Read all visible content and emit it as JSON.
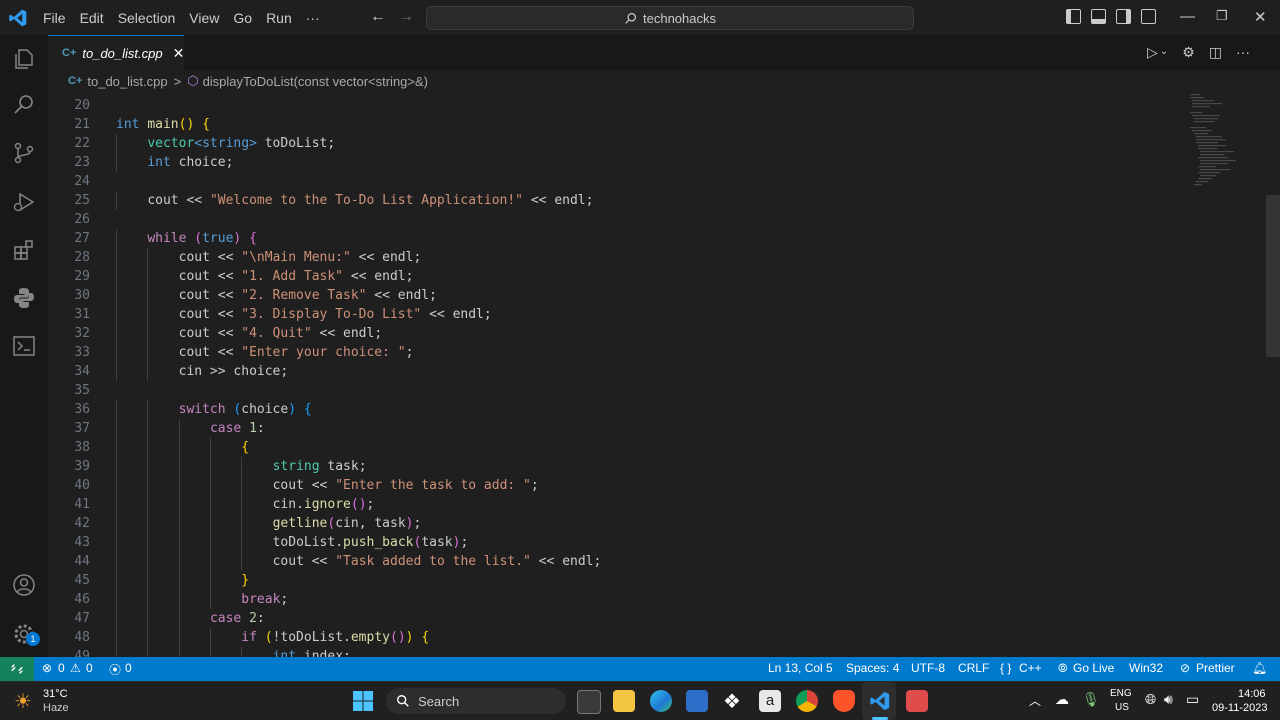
{
  "menu": [
    "File",
    "Edit",
    "Selection",
    "View",
    "Go",
    "Run",
    "···"
  ],
  "command_center": "technohacks",
  "tab": {
    "icon": "C+",
    "label": "to_do_list.cpp",
    "close": "✕"
  },
  "breadcrumb": {
    "file_icon": "C+",
    "file": "to_do_list.cpp",
    "separator": ">",
    "symbol_icon": "⬡",
    "symbol": "displayToDoList(const vector<string>&)"
  },
  "code_lines": [
    {
      "n": "20",
      "indent": 0,
      "tokens": []
    },
    {
      "n": "21",
      "indent": 0,
      "tokens": [
        [
          "kw",
          "int"
        ],
        [
          "p",
          " "
        ],
        [
          "fn",
          "main"
        ],
        [
          "br1",
          "()"
        ],
        [
          "p",
          " "
        ],
        [
          "br1",
          "{"
        ]
      ]
    },
    {
      "n": "22",
      "indent": 1,
      "tokens": [
        [
          "ty",
          "vector"
        ],
        [
          "kw",
          "<string>"
        ],
        [
          "p",
          " toDoList;"
        ]
      ]
    },
    {
      "n": "23",
      "indent": 1,
      "tokens": [
        [
          "kw",
          "int"
        ],
        [
          "p",
          " choice;"
        ]
      ]
    },
    {
      "n": "24",
      "indent": 0,
      "tokens": []
    },
    {
      "n": "25",
      "indent": 1,
      "tokens": [
        [
          "p",
          "cout << "
        ],
        [
          "str",
          "\"Welcome to the To-Do List Application!\""
        ],
        [
          "p",
          " << endl;"
        ]
      ]
    },
    {
      "n": "26",
      "indent": 0,
      "tokens": []
    },
    {
      "n": "27",
      "indent": 1,
      "tokens": [
        [
          "ctl",
          "while"
        ],
        [
          "p",
          " "
        ],
        [
          "br2",
          "("
        ],
        [
          "kw",
          "true"
        ],
        [
          "br2",
          ")"
        ],
        [
          "p",
          " "
        ],
        [
          "br2",
          "{"
        ]
      ]
    },
    {
      "n": "28",
      "indent": 2,
      "tokens": [
        [
          "p",
          "cout << "
        ],
        [
          "str",
          "\"\\nMain Menu:\""
        ],
        [
          "p",
          " << endl;"
        ]
      ]
    },
    {
      "n": "29",
      "indent": 2,
      "tokens": [
        [
          "p",
          "cout << "
        ],
        [
          "str",
          "\"1. Add Task\""
        ],
        [
          "p",
          " << endl;"
        ]
      ]
    },
    {
      "n": "30",
      "indent": 2,
      "tokens": [
        [
          "p",
          "cout << "
        ],
        [
          "str",
          "\"2. Remove Task\""
        ],
        [
          "p",
          " << endl;"
        ]
      ]
    },
    {
      "n": "31",
      "indent": 2,
      "tokens": [
        [
          "p",
          "cout << "
        ],
        [
          "str",
          "\"3. Display To-Do List\""
        ],
        [
          "p",
          " << endl;"
        ]
      ]
    },
    {
      "n": "32",
      "indent": 2,
      "tokens": [
        [
          "p",
          "cout << "
        ],
        [
          "str",
          "\"4. Quit\""
        ],
        [
          "p",
          " << endl;"
        ]
      ]
    },
    {
      "n": "33",
      "indent": 2,
      "tokens": [
        [
          "p",
          "cout << "
        ],
        [
          "str",
          "\"Enter your choice: \""
        ],
        [
          "p",
          ";"
        ]
      ]
    },
    {
      "n": "34",
      "indent": 2,
      "tokens": [
        [
          "p",
          "cin >> choice;"
        ]
      ]
    },
    {
      "n": "35",
      "indent": 0,
      "tokens": []
    },
    {
      "n": "36",
      "indent": 2,
      "tokens": [
        [
          "ctl",
          "switch"
        ],
        [
          "p",
          " "
        ],
        [
          "br3",
          "("
        ],
        [
          "p",
          "choice"
        ],
        [
          "br3",
          ")"
        ],
        [
          "p",
          " "
        ],
        [
          "br3",
          "{"
        ]
      ]
    },
    {
      "n": "37",
      "indent": 3,
      "tokens": [
        [
          "ctl",
          "case"
        ],
        [
          "p",
          " "
        ],
        [
          "num",
          "1"
        ],
        [
          "p",
          ":"
        ]
      ]
    },
    {
      "n": "38",
      "indent": 4,
      "tokens": [
        [
          "br1",
          "{"
        ]
      ]
    },
    {
      "n": "39",
      "indent": 5,
      "tokens": [
        [
          "ty",
          "string"
        ],
        [
          "p",
          " task;"
        ]
      ]
    },
    {
      "n": "40",
      "indent": 5,
      "tokens": [
        [
          "p",
          "cout << "
        ],
        [
          "str",
          "\"Enter the task to add: \""
        ],
        [
          "p",
          ";"
        ]
      ]
    },
    {
      "n": "41",
      "indent": 5,
      "tokens": [
        [
          "p",
          "cin."
        ],
        [
          "fn",
          "ignore"
        ],
        [
          "br2",
          "()"
        ],
        [
          "p",
          ";"
        ]
      ]
    },
    {
      "n": "42",
      "indent": 5,
      "tokens": [
        [
          "fn",
          "getline"
        ],
        [
          "br2",
          "("
        ],
        [
          "p",
          "cin, task"
        ],
        [
          "br2",
          ")"
        ],
        [
          "p",
          ";"
        ]
      ]
    },
    {
      "n": "43",
      "indent": 5,
      "tokens": [
        [
          "p",
          "toDoList."
        ],
        [
          "fn",
          "push_back"
        ],
        [
          "br2",
          "("
        ],
        [
          "p",
          "task"
        ],
        [
          "br2",
          ")"
        ],
        [
          "p",
          ";"
        ]
      ]
    },
    {
      "n": "44",
      "indent": 5,
      "tokens": [
        [
          "p",
          "cout << "
        ],
        [
          "str",
          "\"Task added to the list.\""
        ],
        [
          "p",
          " << endl;"
        ]
      ]
    },
    {
      "n": "45",
      "indent": 4,
      "tokens": [
        [
          "br1",
          "}"
        ]
      ]
    },
    {
      "n": "46",
      "indent": 4,
      "tokens": [
        [
          "ctl",
          "break"
        ],
        [
          "p",
          ";"
        ]
      ]
    },
    {
      "n": "47",
      "indent": 3,
      "tokens": [
        [
          "ctl",
          "case"
        ],
        [
          "p",
          " "
        ],
        [
          "num",
          "2"
        ],
        [
          "p",
          ":"
        ]
      ]
    },
    {
      "n": "48",
      "indent": 4,
      "tokens": [
        [
          "ctl",
          "if"
        ],
        [
          "p",
          " "
        ],
        [
          "br1",
          "("
        ],
        [
          "p",
          "!toDoList."
        ],
        [
          "fn",
          "empty"
        ],
        [
          "br2",
          "()"
        ],
        [
          "br1",
          ")"
        ],
        [
          "p",
          " "
        ],
        [
          "br1",
          "{"
        ]
      ]
    },
    {
      "n": "49",
      "indent": 5,
      "tokens": [
        [
          "kw",
          "int"
        ],
        [
          "p",
          " index;"
        ]
      ]
    }
  ],
  "status": {
    "errors": "0",
    "warnings": "0",
    "ports": "0",
    "position": "Ln 13, Col 5",
    "spaces": "Spaces: 4",
    "encoding": "UTF-8",
    "eol": "CRLF",
    "language": "C++",
    "language_icon": "{ }",
    "golive": "Go Live",
    "platform": "Win32",
    "prettier": "Prettier"
  },
  "activity_badge": "1",
  "taskbar": {
    "weather_temp": "31°C",
    "weather_desc": "Haze",
    "search": "Search",
    "lang_top": "ENG",
    "lang_bottom": "US",
    "time": "14:06",
    "date": "09-11-2023"
  },
  "colors": {
    "accent": "#007acc",
    "remote": "#16825d",
    "editor_bg": "#1f1f1f"
  }
}
